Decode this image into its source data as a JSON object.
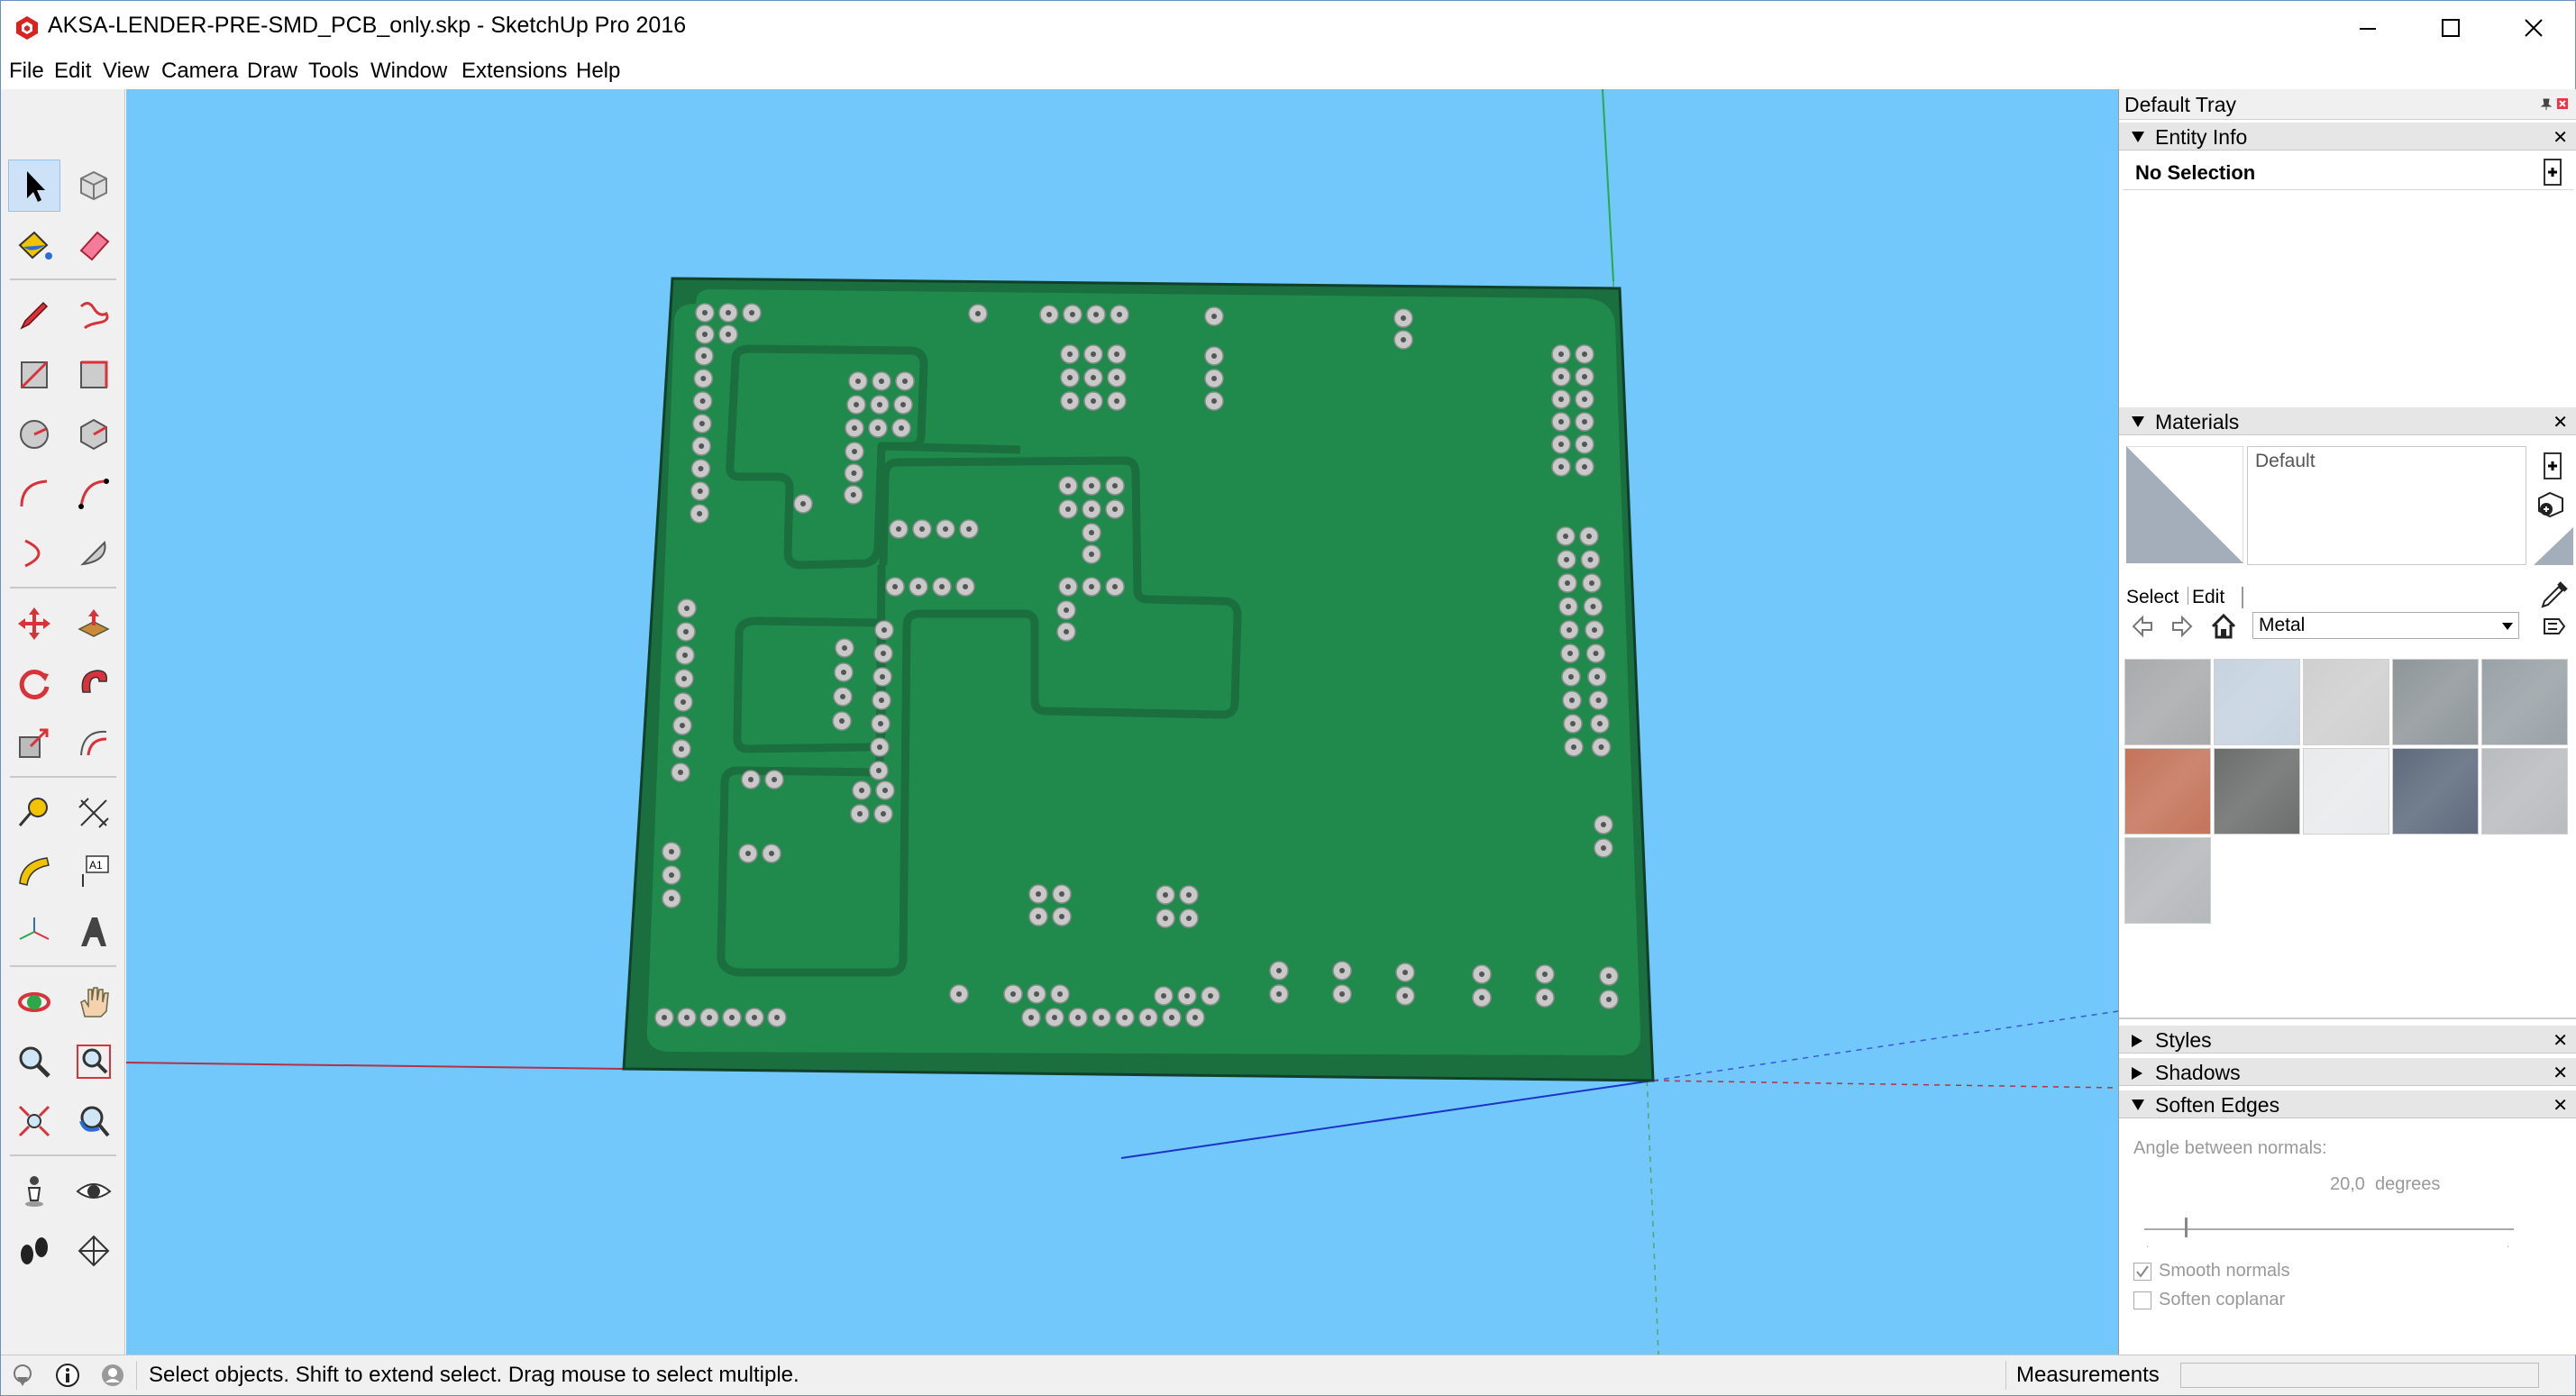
{
  "window": {
    "title": "AKSA-LENDER-PRE-SMD_PCB_only.skp - SketchUp Pro 2016",
    "controls": [
      "minimize-icon",
      "maximize-icon",
      "close-icon"
    ]
  },
  "menu": [
    "File",
    "Edit",
    "View",
    "Camera",
    "Draw",
    "Tools",
    "Window",
    "Extensions",
    "Help"
  ],
  "toolbar": {
    "tools": [
      "select-icon",
      "component-icon",
      "paint-bucket-icon",
      "eraser-icon",
      "pencil-line-icon",
      "freehand-icon",
      "rectangle-icon",
      "rotated-rectangle-icon",
      "circle-icon",
      "polygon-icon",
      "arc-icon",
      "two-point-arc-icon",
      "three-point-arc-icon",
      "pie-icon",
      "move-icon",
      "push-pull-icon",
      "rotate-icon",
      "follow-me-icon",
      "scale-icon",
      "offset-icon",
      "tape-measure-icon",
      "dimension-icon",
      "protractor-icon",
      "text-icon",
      "axes-icon",
      "3d-text-icon",
      "orbit-icon",
      "pan-icon",
      "zoom-icon",
      "zoom-window-icon",
      "zoom-extents-icon",
      "previous-view-icon",
      "position-camera-icon",
      "look-around-icon",
      "walk-icon",
      "section-plane-icon"
    ],
    "selected": "select-icon"
  },
  "viewport": {
    "background": "#72c7fb",
    "model": {
      "board_color": "#1f8a4c",
      "board_edge_color": "#1b6e3d",
      "pad_color": "#c9c9c9"
    }
  },
  "tray": {
    "title": "Default Tray",
    "entity_info": {
      "label": "Entity Info",
      "selection": "No Selection"
    },
    "materials": {
      "label": "Materials",
      "current_name": "Default",
      "tab_select": "Select",
      "tab_edit": "Edit",
      "collection": "Metal",
      "swatch_colors": [
        "#a8aaac",
        "#c6d3df",
        "#cfcfcf",
        "#8f969a",
        "#99a2a7",
        "#c4745a",
        "#6b6e6c",
        "#e9eaec",
        "#5e6a7c",
        "#b9bcbf",
        "#b5b8ba"
      ]
    },
    "styles_label": "Styles",
    "shadows_label": "Shadows",
    "soften_edges": {
      "label": "Soften Edges",
      "angle_label": "Angle between normals:",
      "angle_value": "20,0  degrees",
      "slider_fraction": 0.11,
      "smooth_normals_label": "Smooth normals",
      "smooth_normals_checked": true,
      "soften_coplanar_label": "Soften coplanar",
      "soften_coplanar_checked": false
    }
  },
  "status": {
    "message": "Select objects. Shift to extend select. Drag mouse to select multiple.",
    "measurements_label": "Measurements",
    "measurements_value": ""
  }
}
